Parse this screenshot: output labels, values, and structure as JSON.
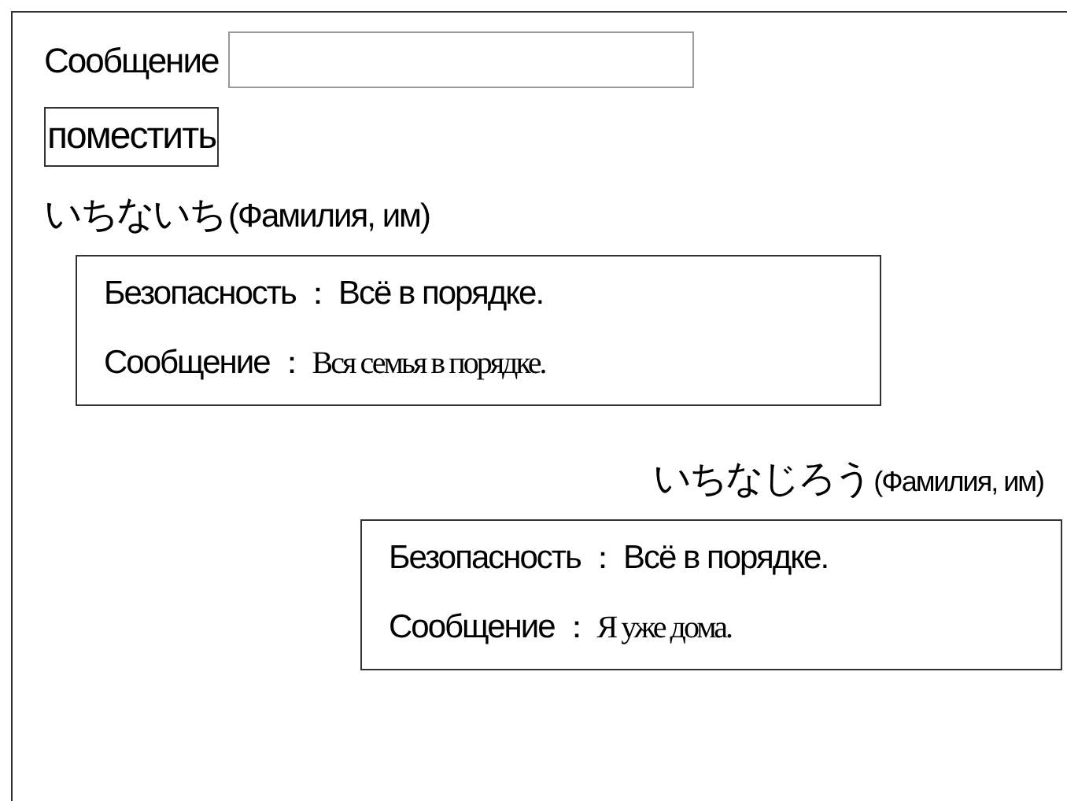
{
  "form": {
    "label": "Сообщение",
    "button": "поместить"
  },
  "posts": [
    {
      "kind": "incoming",
      "name": "いちないち",
      "name_note": "(Фамилия, им)",
      "lines": [
        {
          "kind": "status",
          "label": "Безопасность",
          "separator": "：",
          "value": "Всё в порядке."
        },
        {
          "kind": "message",
          "label": "Сообщение",
          "separator": "：",
          "value": "Вся семья в порядке."
        }
      ]
    },
    {
      "kind": "outgoing",
      "name": "いちなじろう",
      "name_note": "(Фамилия, им)",
      "lines": [
        {
          "kind": "status",
          "label": "Безопасность",
          "separator": "：",
          "value": "Всё в порядке."
        },
        {
          "kind": "message",
          "label": "Сообщение",
          "separator": "：",
          "value": "Я уже дома."
        }
      ]
    }
  ]
}
